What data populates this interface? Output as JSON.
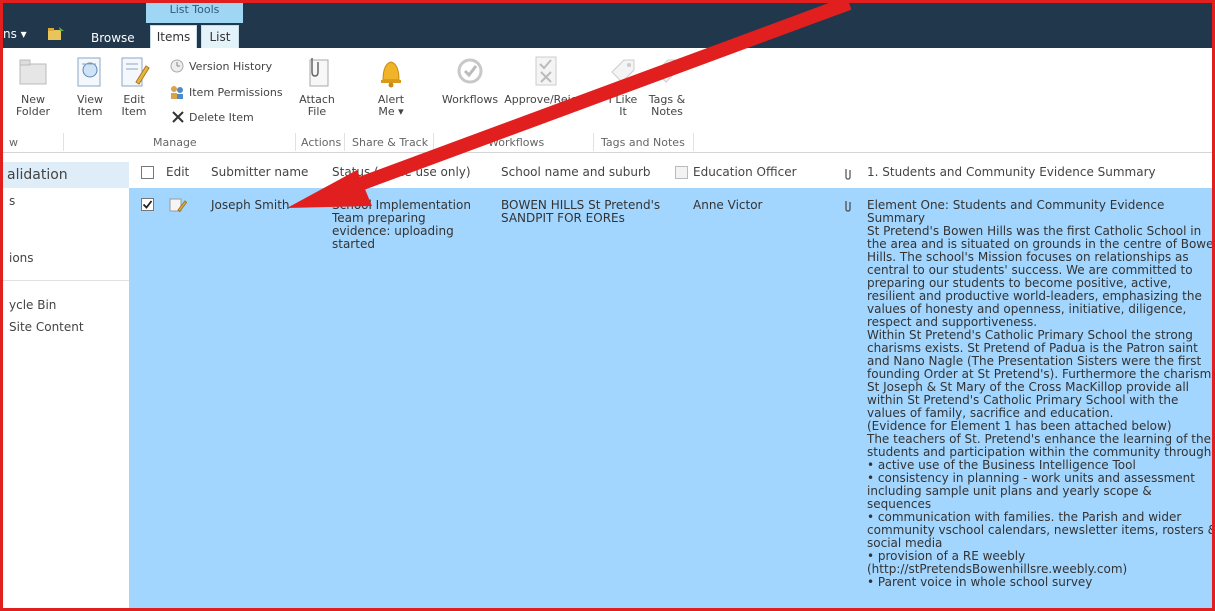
{
  "topbar": {
    "site_actions": "ns ▾",
    "browse_tab": "Browse",
    "context_group": "List Tools",
    "items_tab": "Items",
    "list_tab": "List"
  },
  "ribbon": {
    "new_folder": "New\nFolder",
    "view_item": "View\nItem",
    "edit_item": "Edit\nItem",
    "version_history": "Version History",
    "item_permissions": "Item Permissions",
    "delete_item": "Delete Item",
    "attach_file": "Attach\nFile",
    "alert_me": "Alert\nMe ▾",
    "workflows": "Workflows",
    "approve_reject": "Approve/Reject",
    "i_like_it": "I Like\nIt",
    "tags_notes": "Tags &\nNotes",
    "groups": {
      "new": "w",
      "manage": "Manage",
      "actions": "Actions",
      "share_track": "Share & Track",
      "workflows": "Workflows",
      "tags_notes": "Tags and Notes"
    }
  },
  "leftnav": {
    "heading": "alidation",
    "items": [
      "s",
      "ions",
      "ycle Bin",
      "Site Content"
    ]
  },
  "list": {
    "columns": {
      "edit": "Edit",
      "submitter": "Submitter name",
      "status": "Status (office use only)",
      "school": "School name and suburb",
      "education_officer": "Education Officer",
      "summary": "1. Students and Community Evidence Summary"
    },
    "row": {
      "submitter": "Joseph Smith",
      "status": "School Implementation\nTeam preparing\nevidence: uploading\nstarted",
      "school": "BOWEN HILLS St Pretend's\nSANDPIT FOR EOREs",
      "education_officer": "Anne Victor",
      "summary": "Element One: Students and Community Evidence\nSummary\nSt Pretend's Bowen Hills was the first Catholic School in\nthe area and is situated on grounds in the centre of Bowe\nHills. The school's Mission focuses on relationships as\ncentral to our students' success. We are committed to\npreparing our students to become positive, active,\nresilient and productive world-leaders, emphasizing the\nvalues of honesty and openness, initiative, diligence,\nrespect and supportiveness.\nWithin St Pretend's Catholic Primary School the strong\ncharisms exists. St Pretend of Padua is the Patron saint\nand Nano Nagle (The Presentation Sisters were the first\nfounding Order at St Pretend's). Furthermore the charism\nSt Joseph & St Mary of the Cross MacKillop provide all\nwithin St Pretend's Catholic Primary School with the\nvalues of family, sacrifice and education.\n(Evidence for Element 1 has been attached below)\nThe teachers of St. Pretend's enhance the learning of thei\nstudents and participation within the community through;\n• active use of the Business Intelligence Tool\n• consistency in planning - work units and assessment\nincluding sample unit plans and yearly scope & sequences\n• communication with families. the Parish and wider\ncommunity vschool calendars, newsletter items, rosters &\nsocial media\n• provision of a RE weebly\n(http://stPretendsBowenhillsre.weebly.com)\n• Parent voice in whole school survey"
    }
  },
  "colors": {
    "topbar": "#21374c",
    "selected_row": "#a3d6ff",
    "annotation": "#e21f1f"
  }
}
